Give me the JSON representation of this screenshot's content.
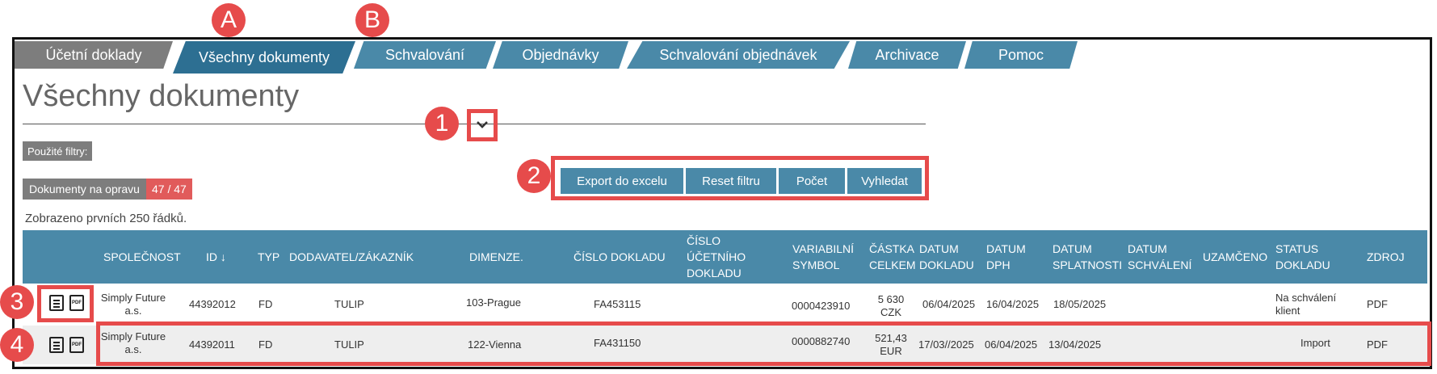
{
  "tabs": [
    {
      "label": "Účetní doklady"
    },
    {
      "label": "Všechny dokumenty"
    },
    {
      "label": "Schvalování"
    },
    {
      "label": "Objednávky"
    },
    {
      "label": "Schvalování objednávek"
    },
    {
      "label": "Archivace"
    },
    {
      "label": "Pomoc"
    }
  ],
  "annotations": {
    "a": "A",
    "b": "B",
    "n1": "1",
    "n2": "2",
    "n3": "3",
    "n4": "4"
  },
  "page_title": "Všechny dokumenty",
  "filters_label": "Použité filtry:",
  "buttons": {
    "export": "Export do excelu",
    "reset": "Reset filtru",
    "count": "Počet",
    "search": "Vyhledat"
  },
  "docs_repair_label": "Dokumenty na opravu",
  "docs_repair_count": "47 / 47",
  "rows_shown": "Zobrazeno prvních 250 řádků.",
  "columns": {
    "company": "SPOLEČNOST",
    "id": "ID ↓",
    "type": "TYP",
    "supplier": "DODAVATEL/ZÁKAZNÍK",
    "dimension": "DIMENZE.",
    "doc_no": "ČÍSLO DOKLADU",
    "acc_no": "ČÍSLO ÚČETNÍHO DOKLADU",
    "var_symbol": "VARIABILNÍ SYMBOL",
    "amount": "ČÁSTKA CELKEM",
    "doc_date": "DATUM DOKLADU",
    "vat_date": "DATUM DPH",
    "due_date": "DATUM SPLATNOSTI",
    "approval_date": "DATUM SCHVÁLENÍ",
    "locked": "UZAMČENO",
    "status": "STATUS DOKLADU",
    "source": "ZDROJ"
  },
  "rows": [
    {
      "company": "Simply Future a.s.",
      "id": "44392012",
      "type": "FD",
      "supplier": "TULIP",
      "dimension": "103-Prague",
      "doc_no": "FA453115",
      "acc_no": "",
      "var_symbol": "0000423910",
      "amount": "5 630 CZK",
      "doc_date": "06/04/2025",
      "vat_date": "16/04/2025",
      "due_date": "18/05/2025",
      "approval_date": "",
      "locked": "",
      "status": "Na schválení klient",
      "source": "PDF"
    },
    {
      "company": "Simply Future a.s.",
      "id": "44392011",
      "type": "FD",
      "supplier": "TULIP",
      "dimension": "122-Vienna",
      "doc_no": "FA431150",
      "acc_no": "",
      "var_symbol": "0000882740",
      "amount": "521,43 EUR",
      "doc_date": "17/03//2025",
      "vat_date": "06/04/2025",
      "due_date": "13/04/2025",
      "approval_date": "",
      "locked": "",
      "status": "Import",
      "source": "PDF"
    }
  ],
  "colors": {
    "tab_blue": "#4a89a8",
    "tab_active": "#2d6f92",
    "tab_grey": "#7d7d7d",
    "annotation_red": "#e64b4b"
  }
}
